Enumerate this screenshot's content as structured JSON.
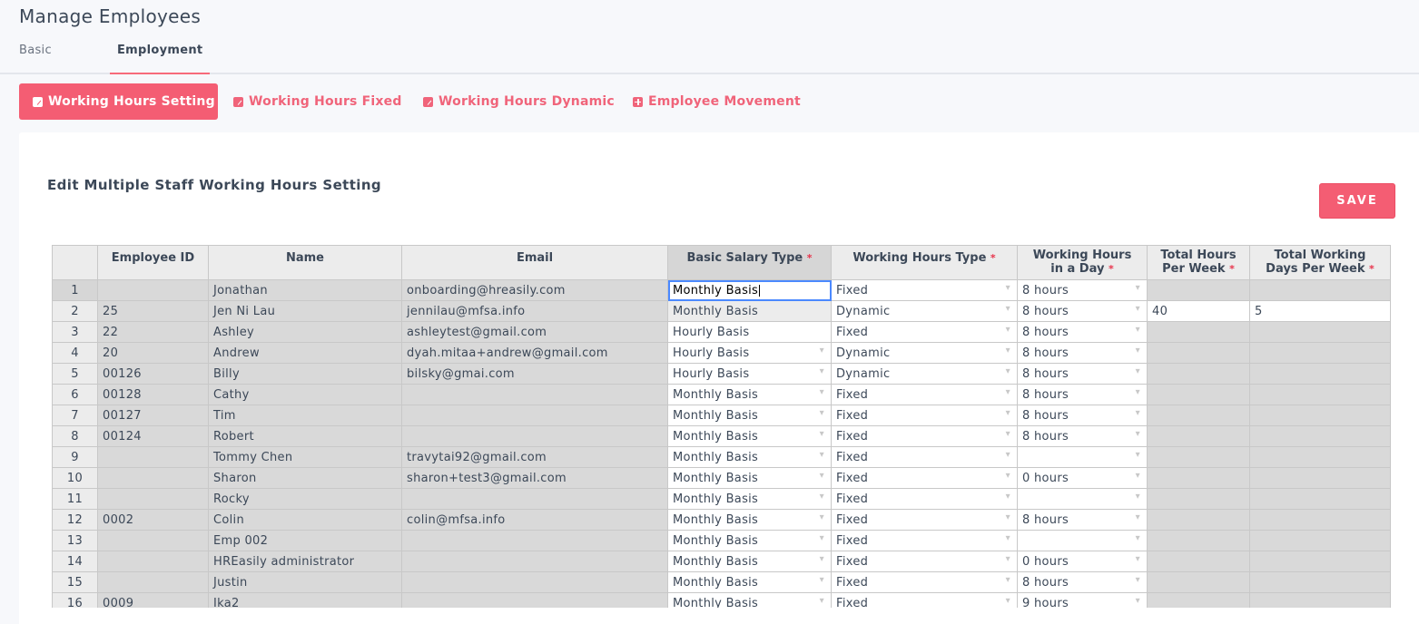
{
  "page_title": "Manage Employees",
  "main_tabs": [
    {
      "label": "Basic"
    },
    {
      "label": "Employment"
    }
  ],
  "sub_tabs": [
    {
      "label": "Working Hours Setting",
      "icon": "edit-icon"
    },
    {
      "label": "Working Hours Fixed",
      "icon": "edit-icon"
    },
    {
      "label": "Working Hours Dynamic",
      "icon": "edit-icon"
    },
    {
      "label": "Employee Movement",
      "icon": "plus-icon"
    }
  ],
  "card": {
    "title": "Edit Multiple Staff Working Hours Setting",
    "save_label": "SAVE"
  },
  "colors": {
    "accent": "#f45d73",
    "required": "#e8344c",
    "selection": "#4b89ff"
  },
  "table": {
    "headers": {
      "employee_id": "Employee ID",
      "name": "Name",
      "email": "Email",
      "salary_type": "Basic Salary Type",
      "hours_type": "Working Hours Type",
      "hours_day_1": "Working Hours",
      "hours_day_2": "in a Day",
      "hours_week_1": "Total Hours",
      "hours_week_2": "Per Week",
      "days_week_1": "Total Working",
      "days_week_2": "Days Per Week",
      "required_mark": "*"
    },
    "rows": [
      {
        "n": "1",
        "id": "",
        "name": "Jonathan",
        "email": "onboarding@hreasily.com",
        "salary": "Monthly Basis",
        "type": "Fixed",
        "day": "8 hours",
        "week": "",
        "days": ""
      },
      {
        "n": "2",
        "id": "25",
        "name": "Jen Ni Lau",
        "email": "jennilau@mfsa.info",
        "salary": "Monthly Basis",
        "type": "Dynamic",
        "day": "8 hours",
        "week": "40",
        "days": "5"
      },
      {
        "n": "3",
        "id": "22",
        "name": "Ashley",
        "email": "ashleytest@gmail.com",
        "salary": "Hourly Basis",
        "type": "Fixed",
        "day": "8 hours",
        "week": "",
        "days": ""
      },
      {
        "n": "4",
        "id": "20",
        "name": "Andrew",
        "email": "dyah.mitaa+andrew@gmail.com",
        "salary": "Hourly Basis",
        "type": "Dynamic",
        "day": "8 hours",
        "week": "",
        "days": ""
      },
      {
        "n": "5",
        "id": "00126",
        "name": "Billy",
        "email": "bilsky@gmai.com",
        "salary": "Hourly Basis",
        "type": "Dynamic",
        "day": "8 hours",
        "week": "",
        "days": ""
      },
      {
        "n": "6",
        "id": "00128",
        "name": "Cathy",
        "email": "",
        "salary": "Monthly Basis",
        "type": "Fixed",
        "day": "8 hours",
        "week": "",
        "days": ""
      },
      {
        "n": "7",
        "id": "00127",
        "name": "Tim",
        "email": "",
        "salary": "Monthly Basis",
        "type": "Fixed",
        "day": "8 hours",
        "week": "",
        "days": ""
      },
      {
        "n": "8",
        "id": "00124",
        "name": "Robert",
        "email": "",
        "salary": "Monthly Basis",
        "type": "Fixed",
        "day": "8 hours",
        "week": "",
        "days": ""
      },
      {
        "n": "9",
        "id": "",
        "name": "Tommy Chen",
        "email": "travytai92@gmail.com",
        "salary": "Monthly Basis",
        "type": "Fixed",
        "day": "",
        "week": "",
        "days": ""
      },
      {
        "n": "10",
        "id": "",
        "name": "Sharon",
        "email": "sharon+test3@gmail.com",
        "salary": "Monthly Basis",
        "type": "Fixed",
        "day": "0 hours",
        "week": "",
        "days": ""
      },
      {
        "n": "11",
        "id": "",
        "name": "Rocky",
        "email": "",
        "salary": "Monthly Basis",
        "type": "Fixed",
        "day": "",
        "week": "",
        "days": ""
      },
      {
        "n": "12",
        "id": "0002",
        "name": "Colin",
        "email": "colin@mfsa.info",
        "salary": "Monthly Basis",
        "type": "Fixed",
        "day": "8 hours",
        "week": "",
        "days": ""
      },
      {
        "n": "13",
        "id": "",
        "name": "Emp 002",
        "email": "",
        "salary": "Monthly Basis",
        "type": "Fixed",
        "day": "",
        "week": "",
        "days": ""
      },
      {
        "n": "14",
        "id": "",
        "name": "HREasily administrator",
        "email": "",
        "salary": "Monthly Basis",
        "type": "Fixed",
        "day": "0 hours",
        "week": "",
        "days": ""
      },
      {
        "n": "15",
        "id": "",
        "name": "Justin",
        "email": "",
        "salary": "Monthly Basis",
        "type": "Fixed",
        "day": "8 hours",
        "week": "",
        "days": ""
      },
      {
        "n": "16",
        "id": "0009",
        "name": "Ika2",
        "email": "",
        "salary": "Monthly Basis",
        "type": "Fixed",
        "day": "9 hours",
        "week": "",
        "days": ""
      }
    ]
  }
}
